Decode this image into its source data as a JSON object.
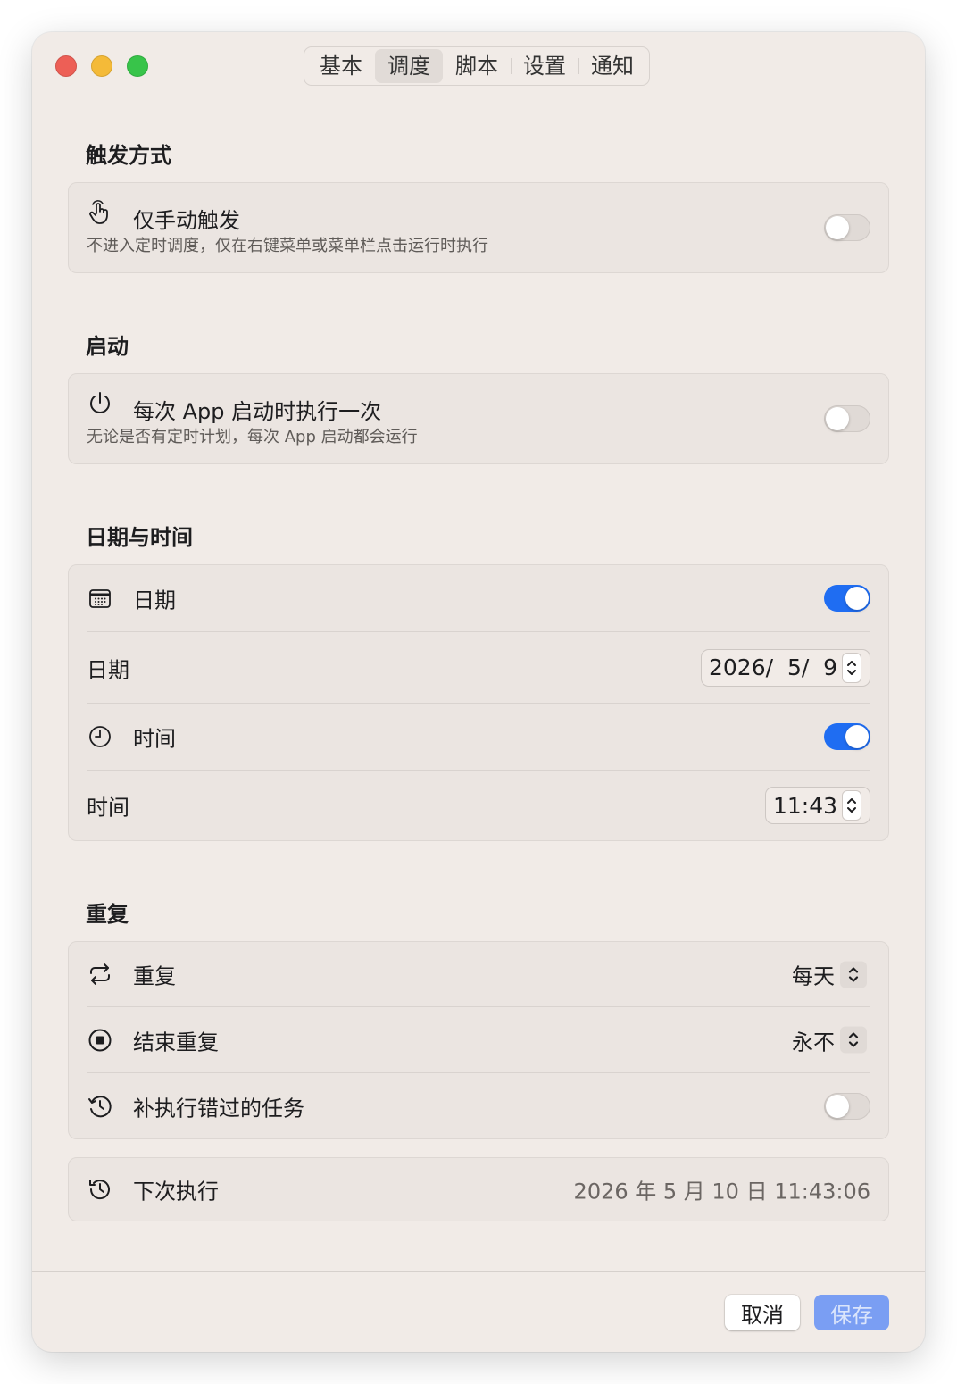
{
  "tabs": [
    {
      "label": "基本",
      "active": false
    },
    {
      "label": "调度",
      "active": true
    },
    {
      "label": "脚本",
      "active": false
    },
    {
      "label": "设置",
      "active": false
    },
    {
      "label": "通知",
      "active": false
    }
  ],
  "trigger": {
    "section_title": "触发方式",
    "manual_only": {
      "label": "仅手动触发",
      "description": "不进入定时调度，仅在右键菜单或菜单栏点击运行时执行",
      "icon": "hand-tap-icon",
      "enabled": false
    }
  },
  "launch": {
    "section_title": "启动",
    "run_on_launch": {
      "label": "每次 App 启动时执行一次",
      "description": "无论是否有定时计划，每次 App 启动都会运行",
      "icon": "power-icon",
      "enabled": false
    }
  },
  "datetime": {
    "section_title": "日期与时间",
    "date_toggle": {
      "label": "日期",
      "icon": "calendar-icon",
      "enabled": true
    },
    "date_field": {
      "label": "日期",
      "value": "2026/  5/  9"
    },
    "time_toggle": {
      "label": "时间",
      "icon": "clock-icon",
      "enabled": true
    },
    "time_field": {
      "label": "时间",
      "value": "11:43"
    }
  },
  "repeat": {
    "section_title": "重复",
    "repeat": {
      "label": "重复",
      "icon": "repeat-icon",
      "value": "每天"
    },
    "end_repeat": {
      "label": "结束重复",
      "icon": "stop-circle-icon",
      "value": "永不"
    },
    "catch_up": {
      "label": "补执行错过的任务",
      "icon": "history-icon",
      "enabled": false
    }
  },
  "next_run": {
    "label": "下次执行",
    "icon": "clock-history-icon",
    "value": "2026 年 5 月 10 日 11:43:06"
  },
  "footer": {
    "cancel_label": "取消",
    "save_label": "保存"
  },
  "colors": {
    "window_bg": "#f1ebe7",
    "card_bg": "#ebe5e1",
    "accent": "#1f6df2",
    "save_disabled": "#7a9ef3"
  }
}
